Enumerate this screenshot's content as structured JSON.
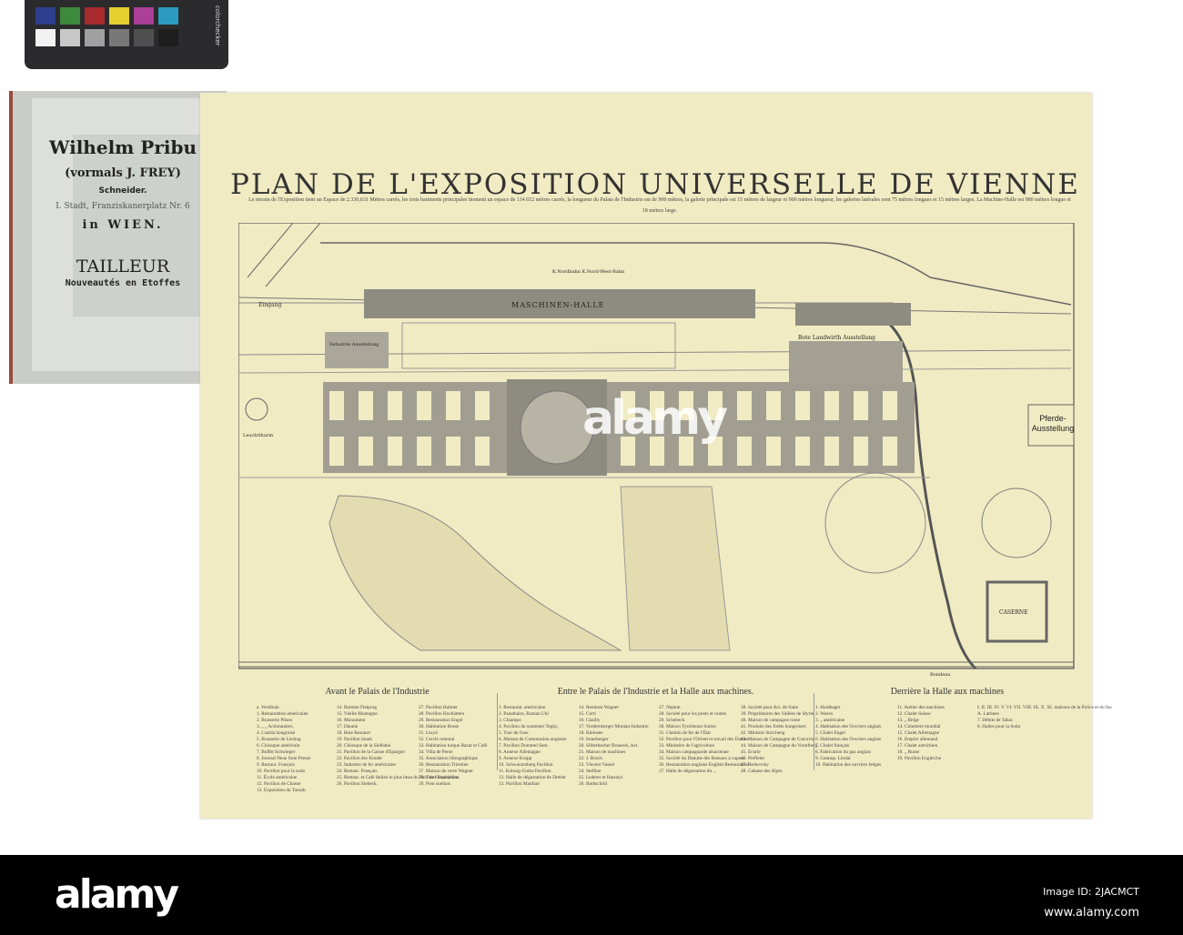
{
  "colors": {
    "sheet": "#f1ebc3",
    "ink": "#333333",
    "building": "#8e8b80",
    "band": "#000000"
  },
  "color_checker": {
    "label": "colorchecker",
    "top_row": [
      "#2d3f8e",
      "#3d8a3c",
      "#a82a2c",
      "#e6cf2e",
      "#ac3f97",
      "#2b9cbf"
    ],
    "bottom_row": [
      "#f2f2f2",
      "#c8c8c8",
      "#a0a0a0",
      "#787878",
      "#4f4f4f",
      "#1e1e1e"
    ]
  },
  "book": {
    "name": "Wilhelm Pribu",
    "formerly": "(vormals J. FREY)",
    "trade": "Schneider.",
    "address": "I. Stadt, Franziskanerplatz Nr. 6",
    "city": "in WIEN.",
    "title": "TAILLEUR",
    "subtitle": "Nouveautés en Etoffes"
  },
  "map": {
    "title": "PLAN DE L'EXPOSITION UNIVERSELLE DE VIENNE",
    "subtitle": "Le terrain de l'Exposition tient un Espace de 2.330,631 Mètres carrés, les trois batiments principales tiennent un espace de 114.652 mètres carrés, la longueur du Palais de l'Industrie est de 900 mètres, la galerie principale est 15 mètres de largeur et 900 mètres longueur, les galeries latérales sont 75 mètres longues et 15 mètres larges. La Machine-Halle est 980 mètres longue et 18 mètres large.",
    "labels": {
      "entrance": "Eingang",
      "machine_hall": "MASCHINEN-HALLE",
      "agriculture": "Bote Landwirth Ausstellung",
      "horse_show": "Pferde-Ausstellung",
      "barracks": "CASERNE",
      "lighthouse": "Leuchtthurm",
      "rondeau": "Rondeau",
      "industry_ausstellung": "Industrie Ausstellung",
      "nordbahn": "K.Nordbahn  K.Nord-West-Bahn"
    }
  },
  "legend": [
    {
      "heading": "Avant le Palais de l'Industrie",
      "columns": [
        [
          "a. Vestibule",
          "1. Restauration américaine",
          "2. Brasserie Pilsen",
          "3. „ „ Actionnaires,",
          "4. Csarda hongroise",
          "5. Brasserie de Liesing",
          "6. Chiosque américain",
          "7. Buffet Schwieger",
          "8. Journal Neue freie Presse",
          "9. Restaur. Français",
          "10. Pavillon pour la soda",
          "11. École américaine",
          "12. Pavillon de Chasse",
          "13. Exposition du Taruab."
        ],
        [
          "14. Romme Fleiprog",
          "15. Vieille Montagne",
          "16. Monument",
          "17. Daunie",
          "18. Bote Restaurt",
          "19. Pavillon Staub",
          "20. Chiosque de la Südbahn",
          "21. Pavillon de la Caisse d'Epargne",
          "22. Pavillon des Kinder",
          "23. Industrie de fer américaine",
          "24. Restaur. Français",
          "25. Restaur. et Café Italien le plus beau du Parc de l'Exposition.",
          "26. Pavillon Siebeck."
        ],
        [
          "27. Pavillon Halmer",
          "28. Pavillon Hochlatten",
          "29. Restauration Engel",
          "30. Habitation Bosse",
          "31. Lloyd",
          "32. Cercle oriental",
          "33. Habitation turque Bazar et Café",
          "34. Villa de Perse",
          "35. Association lithographique",
          "36. Restauration Triestine",
          "37. Maison de verre Wagner",
          "38. Tours américaine",
          "39. Pont suédois"
        ]
      ]
    },
    {
      "heading": "Entre le Palais de l'Industrie et la Halle aux machines.",
      "columns": [
        [
          "1. Restaurat. américaine",
          "2. Panathaire, Roman Uhl",
          "3. Chiampo",
          "4. Pavillon du sommeer Tegky.",
          "5. Tour de l'eau",
          "6. Maison de Commission anglaise",
          "7. Pavillon Dommel Sent.",
          "8. Annexe Allemagne",
          "9. Annexe Krupp",
          "10. Schwarzenberg Pavillon",
          "11. Koburg-Gotha Pavillon",
          "12. Halle de dégustation de Dreher",
          "13. Pavillon Manfaur"
        ],
        [
          "14. Remisen Wagner",
          "15. Corti",
          "16. Chailly",
          "17. Vordernberger   Montan-Industrie",
          "18. Kleinsee",
          "19. Innerberger",
          "20. Silberbacher Brauerei, Act.",
          "21. Maison de machines",
          "22. J. Bosch",
          "23. Vincent Vassel",
          "24. Stefline",
          "25. Lederer et Hasonyi",
          "26. Rothschild"
        ],
        [
          "27. Neptun",
          "28. Société pour les ponts et routes",
          "29. Schebeck",
          "30. Maison Tyrolienne Suisse",
          "31. Chemin de fer de l'État",
          "32. Pavillon pour l'Orient et travail des Dames",
          "33. Ministère de l'agriculture",
          "34. Maison campagnarde alsacienne",
          "35. Société du Danube des Bateaux à vapeur",
          "36. Restauration anglaise English Restauration",
          "37. Halle de dégustation du ..."
        ],
        [
          "38. Société pour Act. de fonte",
          "39. Propriétaires des Vallées de Styrie",
          "40. Maison de campagne russe",
          "41. Produits des forêts hongroises",
          "42. Ministre Stoicheng",
          "43. Maison de Campagne de Cracovie",
          "44. Maison de Campagne du Vorarlberg",
          "45. Ecurie",
          "46. Prefleier",
          "47. Berkovsky",
          "48. Cabane des Alpes"
        ]
      ]
    },
    {
      "heading": "Derrière la Halle aux machines",
      "columns": [
        [
          "1. Haidbager",
          "2. Woern",
          "3. „ américaine",
          "4. Habitation des Ouvriers anglais",
          "5. Chalet Engel",
          "6. Habitation des Ouvriers anglais",
          "7. Chalet français",
          "8. Fabrication du gaz anglais",
          "9. Gannop. Lindal",
          "10. Habitation des ouvriers belges"
        ],
        [
          "11. Atelier des machines",
          "12. Chalet Suisse",
          "13. „ Belge",
          "14. Cimetière mondial",
          "15. Chalet Allemagne",
          "16. Empire allemand",
          "17. Chalet autrichien",
          "18. „ Russe",
          "19. Pavillon Engleiche"
        ],
        [
          "I. II. III. IV. V. VI. VII. VIII. IX. X. XI. maisons de la Police et du feu",
          "A. Latrines",
          "7. Débits de Tabac",
          "8. Halles pour la Soda"
        ]
      ]
    }
  ],
  "watermark": {
    "logo": "alamy",
    "image_id": "Image ID: 2JACMCT",
    "site": "www.alamy.com"
  }
}
